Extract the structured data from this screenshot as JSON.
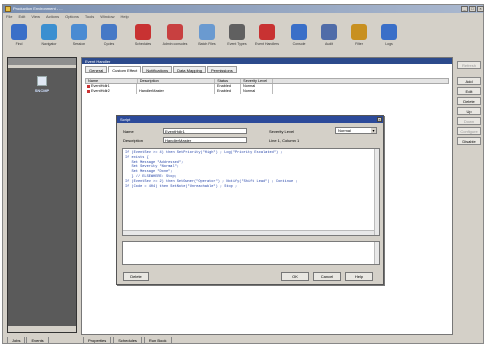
{
  "window": {
    "title": "Production Environment - ..."
  },
  "menu": [
    "File",
    "Edit",
    "View",
    "Actions",
    "Options",
    "Tools",
    "Window",
    "Help"
  ],
  "toolbar": [
    {
      "label": "Find",
      "icon": "magnifier-icon",
      "color": "#3a6fc8"
    },
    {
      "label": "Navigator",
      "icon": "molecule-icon",
      "color": "#3b8fd0"
    },
    {
      "label": "Session",
      "icon": "chat-icon",
      "color": "#4a8bd2"
    },
    {
      "label": "Cycles",
      "icon": "chat-bubble-icon",
      "color": "#4679c6"
    },
    {
      "label": "Schedules",
      "icon": "shield-icon",
      "color": "#c83232"
    },
    {
      "label": "Admin consoles",
      "icon": "people-icon",
      "color": "#c84040"
    },
    {
      "label": "Batch Files",
      "icon": "tools-icon",
      "color": "#6a9ad0"
    },
    {
      "label": "Event Types",
      "icon": "gear-document-icon",
      "color": "#606060"
    },
    {
      "label": "Event Handlers",
      "icon": "star-icon",
      "color": "#c83232"
    },
    {
      "label": "Console",
      "icon": "console-icon",
      "color": "#3a6fc8"
    },
    {
      "label": "Audit",
      "icon": "audit-icon",
      "color": "#506ca8"
    },
    {
      "label": "Filter",
      "icon": "globe-icon",
      "color": "#c89020"
    },
    {
      "label": "Logs",
      "icon": "log-icon",
      "color": "#3a6fc8"
    }
  ],
  "left_nav": {
    "tile_label": "SNCMP"
  },
  "left_tabs": [
    "Jobs",
    "Events"
  ],
  "main": {
    "header": "Event Handler",
    "tabs": [
      "General",
      "Custom Effect",
      "Notifications",
      "Data Mapping",
      "Permissions"
    ],
    "columns": [
      "Name",
      "Description",
      "Status",
      "Severity Level"
    ],
    "rows": [
      [
        "EventHdlr1",
        "",
        "Enabled",
        "Normal"
      ],
      [
        "EventHdlr2",
        "HandlerMaster",
        "Enabled",
        "Normal"
      ]
    ]
  },
  "bottom_tabs": [
    "Properties",
    "Schedules",
    "Run Book"
  ],
  "right_buttons": [
    {
      "label": "Refresh",
      "disabled": true
    },
    {
      "label": "Add",
      "disabled": false
    },
    {
      "label": "Edit",
      "disabled": false
    },
    {
      "label": "Delete",
      "disabled": false
    },
    {
      "label": "Up",
      "disabled": false
    },
    {
      "label": "Down",
      "disabled": true
    },
    {
      "label": "Configure",
      "disabled": true
    },
    {
      "label": "Disable",
      "disabled": false
    }
  ],
  "dialog": {
    "title": "Script",
    "name_label": "Name",
    "name_value": "EventHdlr1",
    "description_label": "Description",
    "description_value": "HandlerMaster",
    "severity_label": "Severity Level",
    "severity_value": "Normal",
    "line_label": "Line 1, Column 1",
    "code_lines": [
      "If (EventSev >= 4) then SetPriority(\"High\") ; Log(\"Priority Escalated\") ;",
      "",
      "If exists {",
      "   Set Message \"Addressed\";",
      "   Set Severity \"Normal\";",
      "   Set Message \"Done\";",
      "   } // ELSEWHERE: Stop;",
      "",
      "If (EventSev >= 2) then SetOwner(\"Operator\") ; Notify(\"Shift Lead\") ; Continue ;",
      "If (Code = 404) then SetNote(\"Unreachable\") ; Stop ;"
    ],
    "buttons": {
      "delete": "Delete",
      "ok": "OK",
      "cancel": "Cancel",
      "help": "Help"
    }
  }
}
